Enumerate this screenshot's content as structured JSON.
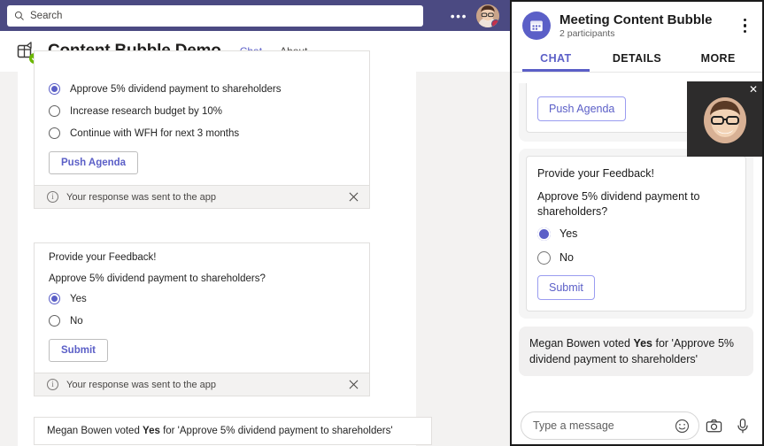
{
  "desktop": {
    "search": {
      "placeholder": "Search",
      "icon": "search-icon"
    },
    "more_label": "•••",
    "app": {
      "title": "Content Bubble Demo",
      "tabs": [
        {
          "label": "Chat",
          "active": true
        },
        {
          "label": "About",
          "active": false
        }
      ]
    },
    "agenda_card": {
      "options": [
        {
          "label": "Approve 5% dividend payment to shareholders",
          "selected": true
        },
        {
          "label": "Increase research budget by 10%",
          "selected": false
        },
        {
          "label": "Continue with WFH for next 3 months",
          "selected": false
        }
      ],
      "button": "Push Agenda",
      "notice": "Your response was sent to the app",
      "notice_close": "✕"
    },
    "feedback_card": {
      "title": "Provide your Feedback!",
      "question": "Approve 5% dividend payment to shareholders?",
      "options": [
        {
          "label": "Yes",
          "selected": true
        },
        {
          "label": "No",
          "selected": false
        }
      ],
      "button": "Submit",
      "notice": "Your response was sent to the app",
      "notice_close": "✕"
    },
    "vote_message": {
      "prefix": "Megan Bowen voted ",
      "bold": "Yes",
      "suffix": " for 'Approve 5% dividend payment to shareholders'"
    }
  },
  "mobile": {
    "header": {
      "title": "Meeting Content Bubble",
      "subtitle": "2 participants",
      "avatar_icon": "calendar-icon",
      "menu_icon": "kebab-menu-icon"
    },
    "tabs": [
      {
        "label": "CHAT",
        "active": true
      },
      {
        "label": "DETAILS",
        "active": false
      },
      {
        "label": "MORE",
        "active": false
      }
    ],
    "agenda_button": "Push Agenda",
    "feedback_card": {
      "title": "Provide your Feedback!",
      "question": "Approve 5% dividend payment to shareholders?",
      "options": [
        {
          "label": "Yes",
          "selected": true
        },
        {
          "label": "No",
          "selected": false
        }
      ],
      "button": "Submit"
    },
    "vote_message": {
      "prefix": "Megan Bowen voted ",
      "bold": "Yes",
      "suffix": " for 'Approve 5% dividend payment to shareholders'"
    },
    "compose": {
      "placeholder": "Type a message",
      "emoji_icon": "emoji-smiley-icon",
      "camera_icon": "camera-icon",
      "mic_icon": "microphone-icon"
    },
    "selfview": {
      "close_label": "✕"
    }
  },
  "colors": {
    "teams_purple": "#5b5fc7",
    "titlebar": "#4b4a82",
    "busy_red": "#c4314b",
    "available_green": "#6bb700",
    "page_bg": "#f3f2f1"
  }
}
